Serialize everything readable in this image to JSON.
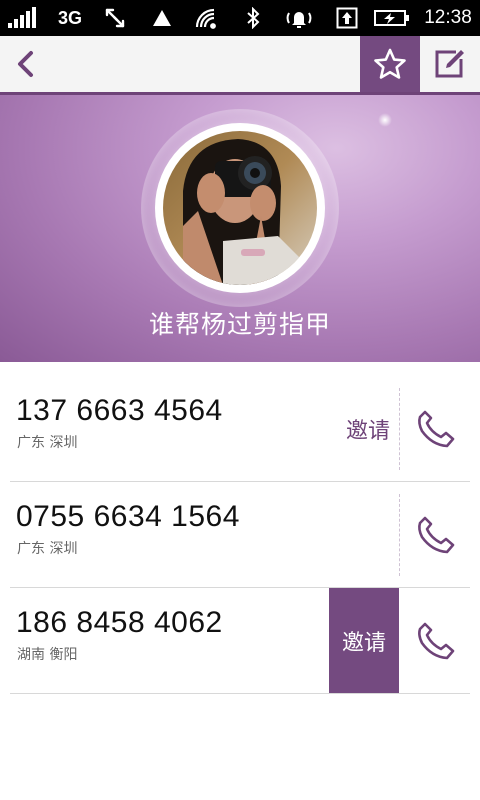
{
  "status_bar": {
    "network": "3G",
    "time": "12:38",
    "icons": [
      "signal-icon",
      "data-transfer-icon",
      "triangle-icon",
      "wifi-icon",
      "bluetooth-icon",
      "alarm-icon",
      "upload-icon",
      "battery-charging-icon"
    ]
  },
  "topbar": {
    "back_icon": "chevron-left-icon",
    "favorite_icon": "star-icon",
    "edit_icon": "edit-icon"
  },
  "contact": {
    "name": "谁帮杨过剪指甲"
  },
  "numbers": [
    {
      "phone": "137 6663 4564",
      "location": "广东 深圳",
      "invite_label": "邀请",
      "invite_style": "text"
    },
    {
      "phone": "0755 6634 1564",
      "location": "广东 深圳",
      "invite_label": "",
      "invite_style": "none"
    },
    {
      "phone": "186 8458 4062",
      "location": "湖南 衡阳",
      "invite_label": "邀请",
      "invite_style": "filled"
    }
  ],
  "colors": {
    "accent": "#744a80",
    "header_light": "#dcbfe2",
    "header_dark": "#8a5a96"
  }
}
